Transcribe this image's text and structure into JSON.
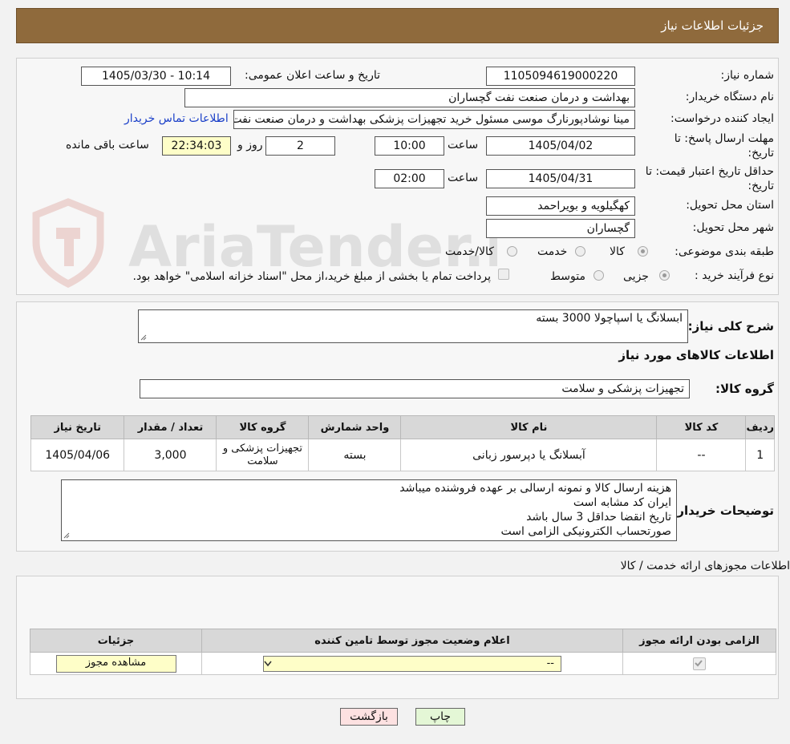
{
  "header": {
    "title": "جزئیات اطلاعات نیاز"
  },
  "form": {
    "need_number_label": "شماره نیاز:",
    "need_number": "1105094619000220",
    "announce_label": "تاریخ و ساعت اعلان عمومی:",
    "announce_value": "1405/03/30 - 10:14",
    "buyer_org_label": "نام دستگاه خریدار:",
    "buyer_org": "بهداشت و درمان صنعت نفت گچساران",
    "requester_label": "ایجاد کننده درخواست:",
    "requester": "مینا نوشادپورنارگ موسی مسئول خرید تجهیزات پزشکی  بهداشت و درمان صنعت نفت گچساران",
    "contact_link": "اطلاعات تماس خریدار",
    "reply_deadline_label": "مهلت ارسال پاسخ: تا تاریخ:",
    "reply_date": "1405/04/02",
    "time_label": "ساعت",
    "reply_time": "10:00",
    "days_value": "2",
    "days_label": "روز و",
    "remaining_value": "22:34:03",
    "remaining_label": "ساعت باقی مانده",
    "price_validity_label": "حداقل تاریخ اعتبار قیمت: تا تاریخ:",
    "price_date": "1405/04/31",
    "price_time": "02:00",
    "province_label": "استان محل تحویل:",
    "province": "کهگیلویه و بویراحمد",
    "city_label": "شهر محل تحویل:",
    "city": "گچساران",
    "category_label": "طبقه بندی موضوعی:",
    "category_options": [
      "کالا",
      "خدمت",
      "کالا/خدمت"
    ],
    "process_label": "نوع فرآیند خرید :",
    "process_options": [
      "جزیی",
      "متوسط"
    ],
    "payment_note": "پرداخت تمام یا بخشی از مبلغ خرید،از محل \"اسناد خزانه اسلامی\" خواهد بود."
  },
  "watermark": {
    "text": "AriaTender.neT"
  },
  "description": {
    "label": "شرح کلی نیاز:",
    "value": "ابسلانگ یا اسپاچولا 3000 بسته",
    "goods_info_title": "اطلاعات کالاهای مورد نیاز",
    "group_label": "گروه کالا:",
    "group_value": "تجهیزات پزشکی و سلامت"
  },
  "goods_table": {
    "headers": [
      "ردیف",
      "کد کالا",
      "نام کالا",
      "واحد شمارش",
      "گروه کالا",
      "تعداد / مقدار",
      "تاریخ نیاز"
    ],
    "rows": [
      [
        "1",
        "--",
        "آبسلانگ یا دپرسور زبانی",
        "بسته",
        "تجهیزات پزشکی و سلامت",
        "3,000",
        "1405/04/06"
      ]
    ]
  },
  "buyer_notes": {
    "label": "توضیحات خریدار:",
    "lines": [
      "هزینه ارسال کالا و نمونه ارسالی بر عهده فروشنده میباشد",
      "ایران کد مشابه است",
      "تاریخ انقضا حداقل 3 سال باشد",
      "صورتحساب الکترونیکی الزامی است"
    ]
  },
  "permits": {
    "title": "اطلاعات مجوزهای ارائه خدمت / کالا",
    "headers": [
      "الزامی بودن ارائه مجوز",
      "اعلام وضعیت مجوز توسط تامین کننده",
      "جزئیات"
    ],
    "select_value": "--",
    "view_button": "مشاهده مجوز"
  },
  "footer": {
    "print_button": "چاپ",
    "back_button": "بازگشت"
  },
  "colors": {
    "header_bg": "#8f6a3c",
    "print_bg": "#e4f7d6",
    "back_bg": "#fde1e1"
  }
}
